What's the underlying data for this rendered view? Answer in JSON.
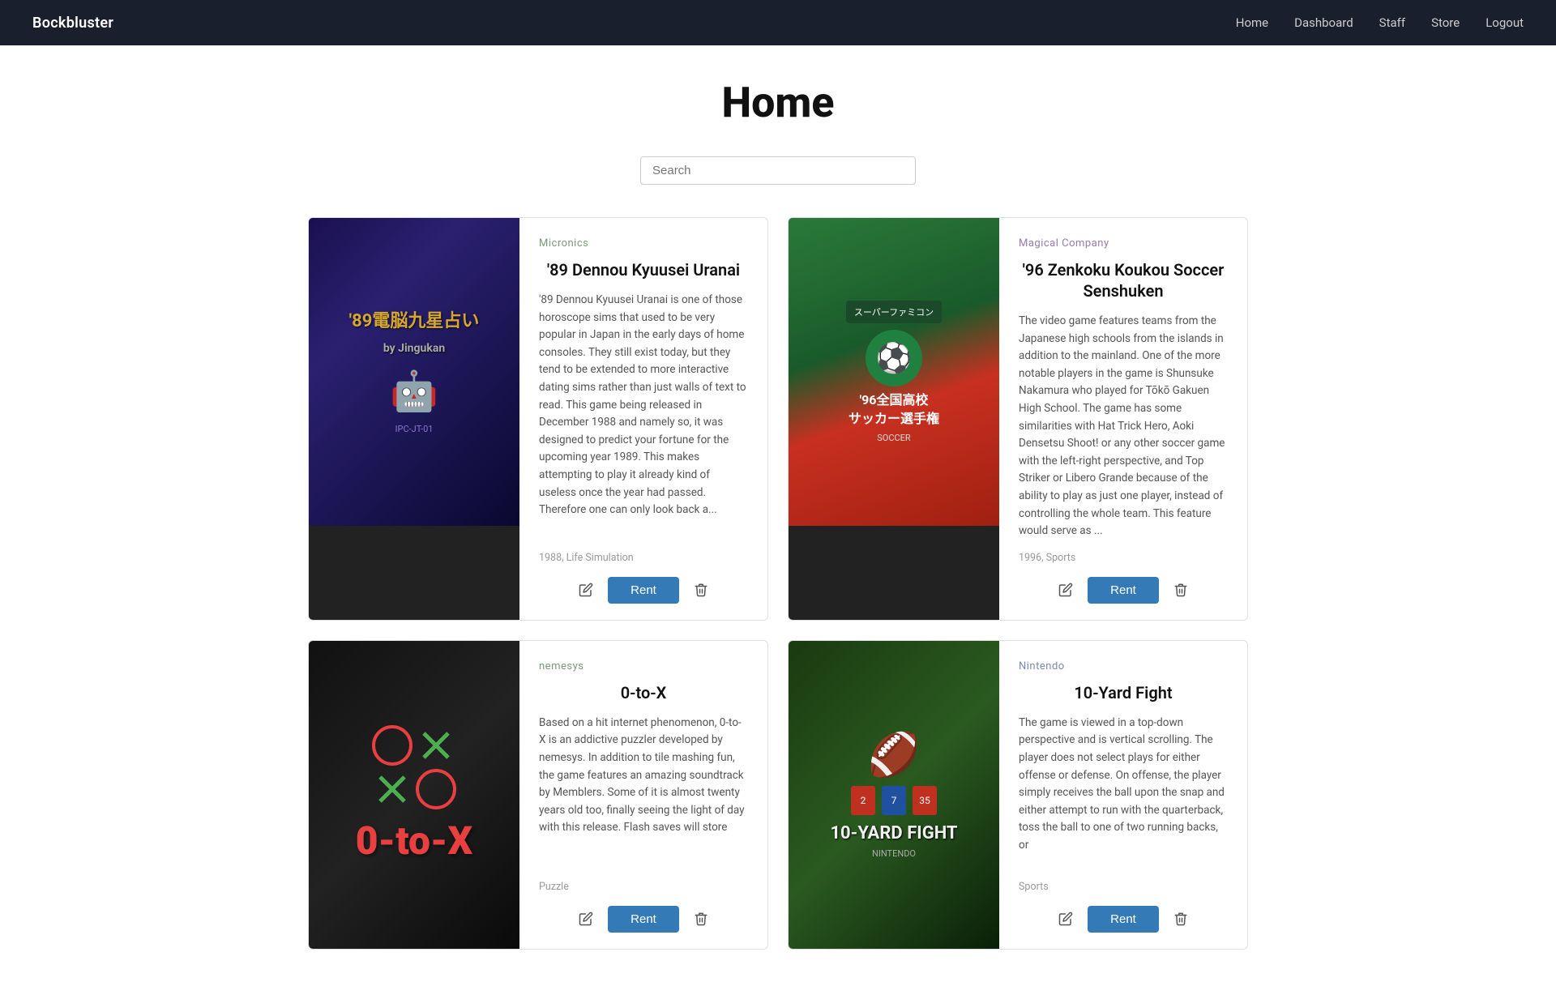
{
  "nav": {
    "brand": "Bockbluster",
    "links": [
      {
        "label": "Home",
        "id": "home"
      },
      {
        "label": "Dashboard",
        "id": "dashboard"
      },
      {
        "label": "Staff",
        "id": "staff"
      },
      {
        "label": "Store",
        "id": "store"
      },
      {
        "label": "Logout",
        "id": "logout"
      }
    ]
  },
  "page": {
    "title": "Home"
  },
  "search": {
    "placeholder": "Search"
  },
  "games": [
    {
      "id": "89-dennou",
      "publisher": "Micronics",
      "publisher_class": "",
      "title": "'89 Dennou Kyuusei Uranai",
      "description": "'89 Dennou Kyuusei Uranai is one of those horoscope sims that used to be very popular in Japan in the early days of home consoles. They still exist today, but they tend to be extended to more interactive dating sims rather than just walls of text to read. This game being released in December 1988 and namely so, it was designed to predict your fortune for the upcoming year 1989. This makes attempting to play it already kind of useless once the year had passed. Therefore one can only look back a...",
      "meta": "1988, Life Simulation",
      "cover_type": "89dennou"
    },
    {
      "id": "96-zenkoku",
      "publisher": "Magical Company",
      "publisher_class": "magical",
      "title": "'96 Zenkoku Koukou Soccer Senshuken",
      "description": "The video game features teams from the Japanese high schools from the islands in addition to the mainland. One of the more notable players in the game is Shunsuke Nakamura who played for Tōkō Gakuen High School. The game has some similarities with Hat Trick Hero, Aoki Densetsu Shoot! or any other soccer game with the left-right perspective, and Top Striker or Libero Grande because of the ability to play as just one player, instead of controlling the whole team. This feature would serve as ...",
      "meta": "1996, Sports",
      "cover_type": "96zenkoku"
    },
    {
      "id": "0-to-x",
      "publisher": "nemesys",
      "publisher_class": "",
      "title": "0-to-X",
      "description": "Based on a hit internet phenomenon, 0-to-X is an addictive puzzler developed by nemesys. In addition to tile mashing fun, the game features an amazing soundtrack by Memblers. Some of it is almost twenty years old too, finally seeing the light of day with this release. Flash saves will store",
      "meta": "Puzzle",
      "cover_type": "0tox"
    },
    {
      "id": "10-yard-fight",
      "publisher": "Nintendo",
      "publisher_class": "nintendo",
      "title": "10-Yard Fight",
      "description": "The game is viewed in a top-down perspective and is vertical scrolling. The player does not select plays for either offense or defense. On offense, the player simply receives the ball upon the snap and either attempt to run with the quarterback, toss the ball to one of two running backs, or",
      "meta": "Sports",
      "cover_type": "10yard"
    }
  ],
  "buttons": {
    "rent": "Rent",
    "edit_icon": "✏",
    "delete_icon": "🗑"
  }
}
